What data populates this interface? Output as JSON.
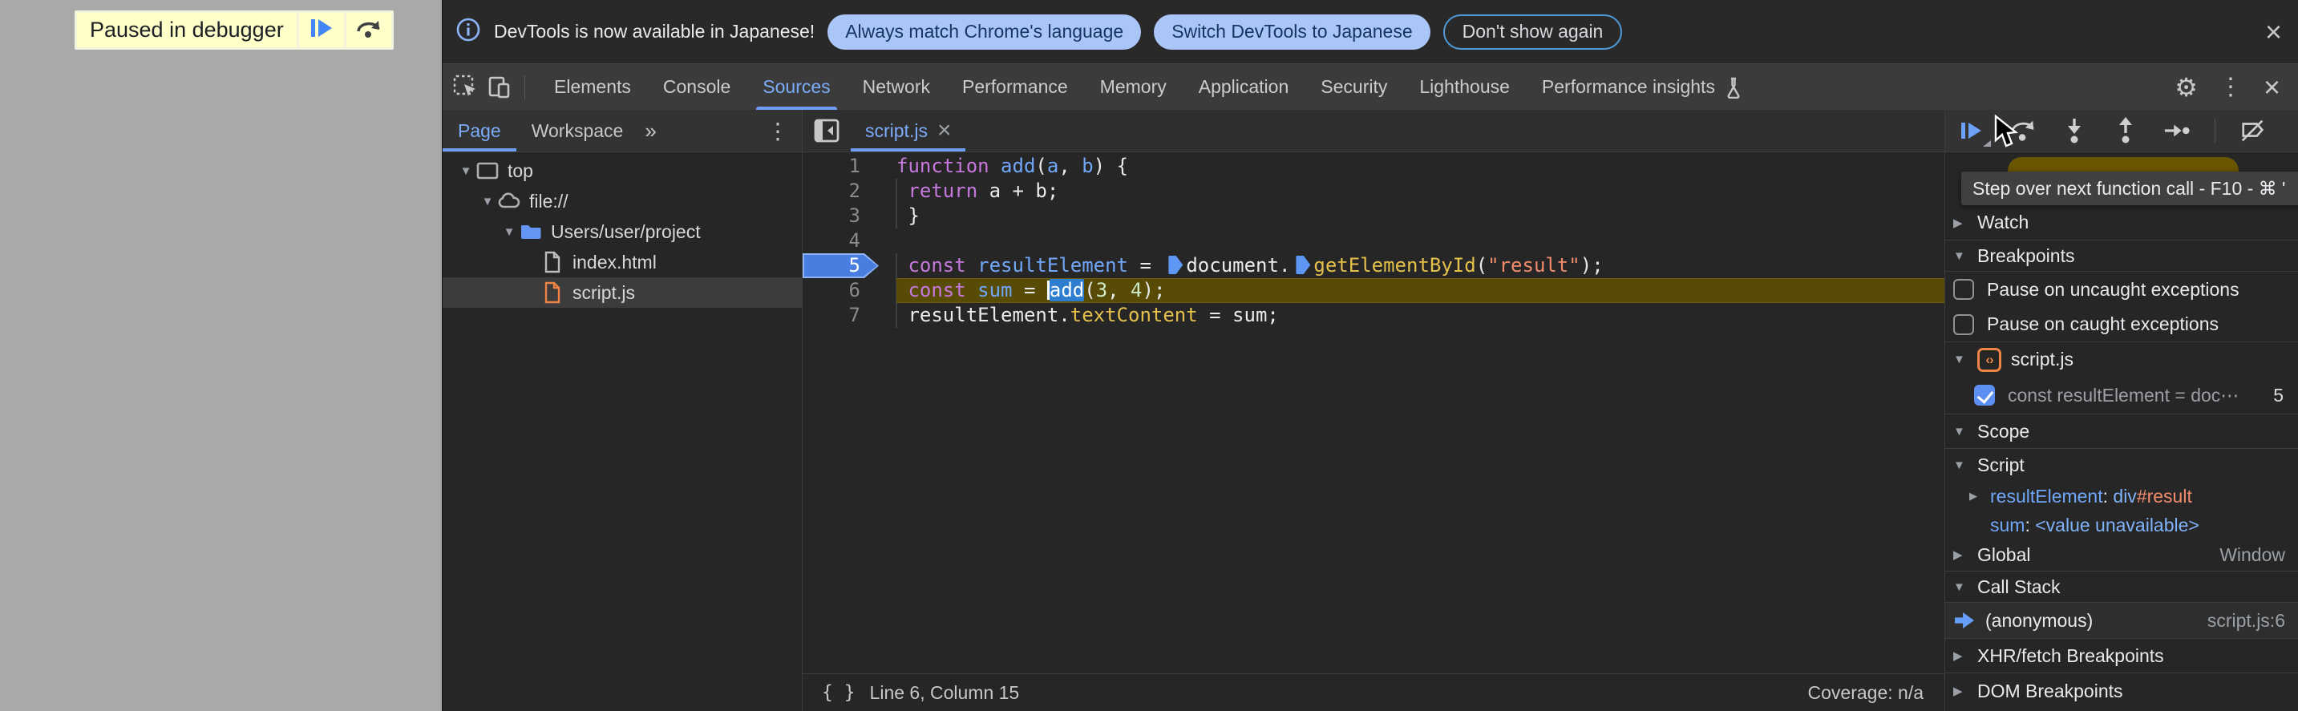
{
  "page": {
    "paused_banner": "Paused in debugger"
  },
  "infobar": {
    "message": "DevTools is now available in Japanese!",
    "buttons": [
      {
        "label": "Always match Chrome's language"
      },
      {
        "label": "Switch DevTools to Japanese"
      },
      {
        "label": "Don't show again"
      }
    ],
    "close": "×"
  },
  "toolbar": {
    "tabs": [
      "Elements",
      "Console",
      "Sources",
      "Network",
      "Performance",
      "Memory",
      "Application",
      "Security",
      "Lighthouse",
      "Performance insights"
    ],
    "active_tab": "Sources",
    "close": "×",
    "more": "⋮",
    "settings": "⚙"
  },
  "navigator": {
    "tabs": [
      "Page",
      "Workspace"
    ],
    "active_tab": "Page",
    "more_tabs": "»",
    "menu": "⋮",
    "tree": [
      {
        "label": "top",
        "icon": "frame-icon",
        "depth": 0,
        "expanded": true
      },
      {
        "label": "file://",
        "icon": "cloud-icon",
        "depth": 1,
        "expanded": true
      },
      {
        "label": "Users/user/project",
        "icon": "folder-icon",
        "depth": 2,
        "expanded": true
      },
      {
        "label": "index.html",
        "icon": "file-icon",
        "depth": 3
      },
      {
        "label": "script.js",
        "icon": "file-js-icon",
        "depth": 3,
        "selected": true
      }
    ]
  },
  "editor": {
    "tab_name": "script.js",
    "tab_close": "×",
    "breakpoint_line": 5,
    "paused_line": 6,
    "code_lines": [
      {
        "num": 1,
        "tokens": [
          [
            "kw",
            "function"
          ],
          [
            "pl",
            " "
          ],
          [
            "var",
            "add"
          ],
          [
            "pl",
            "("
          ],
          [
            "var",
            "a"
          ],
          [
            "pl",
            ", "
          ],
          [
            "var",
            "b"
          ],
          [
            "pl",
            ") {"
          ]
        ]
      },
      {
        "num": 2,
        "tokens": [
          [
            "pl",
            " "
          ],
          [
            "kw",
            "return"
          ],
          [
            "pl",
            " a + b;"
          ]
        ]
      },
      {
        "num": 3,
        "tokens": [
          [
            "pl",
            " }"
          ]
        ]
      },
      {
        "num": 4,
        "tokens": []
      },
      {
        "num": 5,
        "tokens": [
          [
            "pl",
            " "
          ],
          [
            "kw",
            "const"
          ],
          [
            "pl",
            " "
          ],
          [
            "var",
            "resultElement"
          ],
          [
            "pl",
            " = "
          ],
          [
            "marker",
            ""
          ],
          [
            "pl",
            "document."
          ],
          [
            "marker",
            ""
          ],
          [
            "fn",
            "getElementById"
          ],
          [
            "pl",
            "("
          ],
          [
            "str",
            "\"result\""
          ],
          [
            "pl",
            ");"
          ]
        ]
      },
      {
        "num": 6,
        "tokens": [
          [
            "pl",
            " "
          ],
          [
            "kw",
            "const"
          ],
          [
            "pl",
            " "
          ],
          [
            "var",
            "sum"
          ],
          [
            "pl",
            " = "
          ],
          [
            "caret",
            ""
          ],
          [
            "sel",
            "add"
          ],
          [
            "pl",
            "("
          ],
          [
            "num",
            "3"
          ],
          [
            "pl",
            ", "
          ],
          [
            "num",
            "4"
          ],
          [
            "pl",
            ");"
          ]
        ]
      },
      {
        "num": 7,
        "tokens": [
          [
            "pl",
            " "
          ],
          [
            "pl",
            "resultElement."
          ],
          [
            "fn",
            "textContent"
          ],
          [
            "pl",
            " = sum;"
          ]
        ]
      }
    ],
    "status": {
      "brace": "{ }",
      "position": "Line 6, Column 15",
      "coverage": "Coverage: n/a"
    }
  },
  "debugger": {
    "tooltip": "Step over next function call - F10 - ⌘ '",
    "watch_label": "Watch",
    "breakpoints_label": "Breakpoints",
    "pause_uncaught": "Pause on uncaught exceptions",
    "pause_caught": "Pause on caught exceptions",
    "bp_group_file": "script.js",
    "bp_entry": {
      "snippet": "const resultElement = doc⋯",
      "line": "5"
    },
    "scope_label": "Scope",
    "scope_script_label": "Script",
    "vars": [
      {
        "name": "resultElement",
        "sep": ": ",
        "value_tag": "div",
        "value_id": "#result"
      },
      {
        "name": "sum",
        "sep": ": ",
        "value": "<value unavailable>"
      }
    ],
    "global_label": "Global",
    "global_value": "Window",
    "callstack_label": "Call Stack",
    "frame": {
      "name": "(anonymous)",
      "location": "script.js:6"
    },
    "xhr_label": "XHR/fetch Breakpoints",
    "dom_label": "DOM Breakpoints"
  }
}
